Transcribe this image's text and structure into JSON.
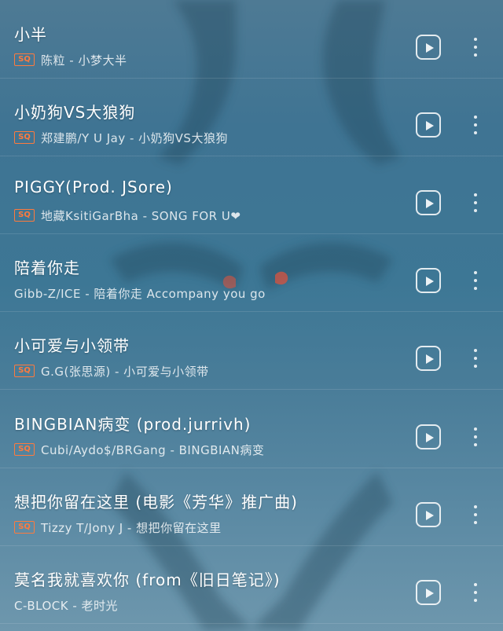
{
  "playlist": {
    "songs": [
      {
        "title": "小半",
        "meta": "陈粒 - 小梦大半",
        "sq": true
      },
      {
        "title": "小奶狗VS大狼狗",
        "meta": "郑建鹏/Y U Jay - 小奶狗VS大狼狗",
        "sq": true
      },
      {
        "title": "PIGGY(Prod. JSore)",
        "meta": "地藏KsitiGarBha - SONG FOR U❤",
        "sq": true
      },
      {
        "title": "陪着你走",
        "meta": "Gibb-Z/ICE - 陪着你走 Accompany you go",
        "sq": false
      },
      {
        "title": "小可爱与小领带",
        "meta": "G.G(张思源) - 小可爱与小领带",
        "sq": true
      },
      {
        "title": "BINGBIAN病变 (prod.jurrivh)",
        "meta": "Cubi/Aydo$/BRGang - BINGBIAN病变",
        "sq": true
      },
      {
        "title": "想把你留在这里 (电影《芳华》推广曲)",
        "meta": "Tizzy T/Jony J - 想把你留在这里",
        "sq": true
      },
      {
        "title": "莫名我就喜欢你 (from《旧日笔记》)",
        "meta": "C-BLOCK - 老时光",
        "sq": false
      }
    ],
    "sq_badge": "SQ",
    "icons": {
      "play": "play-icon",
      "more": "more-vertical-icon"
    },
    "accent": "#ff7a3d"
  }
}
